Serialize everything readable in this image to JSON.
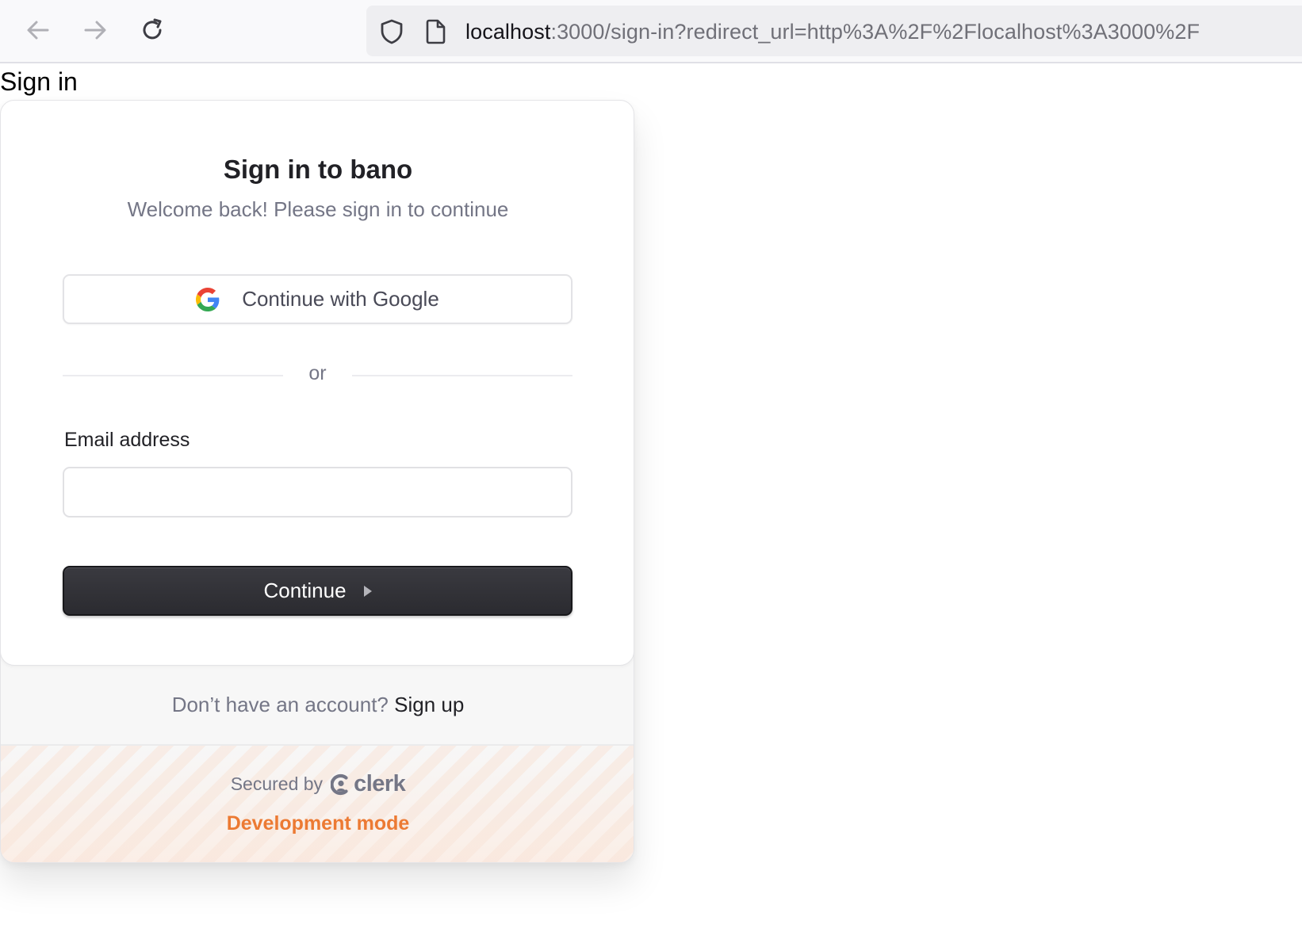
{
  "browser": {
    "url_host": "localhost",
    "url_rest": ":3000/sign-in?redirect_url=http%3A%2F%2Flocalhost%3A3000%2F",
    "icons": {
      "back": "arrow-left-icon",
      "forward": "arrow-right-icon",
      "reload": "reload-icon",
      "security": "shield-icon",
      "page": "page-icon"
    }
  },
  "page": {
    "heading": "Sign in"
  },
  "card": {
    "title": "Sign in to bano",
    "subtitle": "Welcome back! Please sign in to continue",
    "google_button_label": "Continue with Google",
    "divider_text": "or",
    "email_label": "Email address",
    "email_value": "",
    "continue_label": "Continue",
    "signup_prompt": "Don’t have an account?",
    "signup_link": "Sign up",
    "secured_by": "Secured by",
    "clerk_brand": "clerk",
    "dev_mode": "Development mode"
  },
  "colors": {
    "primary_button": "#2f2f34",
    "dev_mode": "#ec7a33",
    "muted_text": "#747686"
  }
}
